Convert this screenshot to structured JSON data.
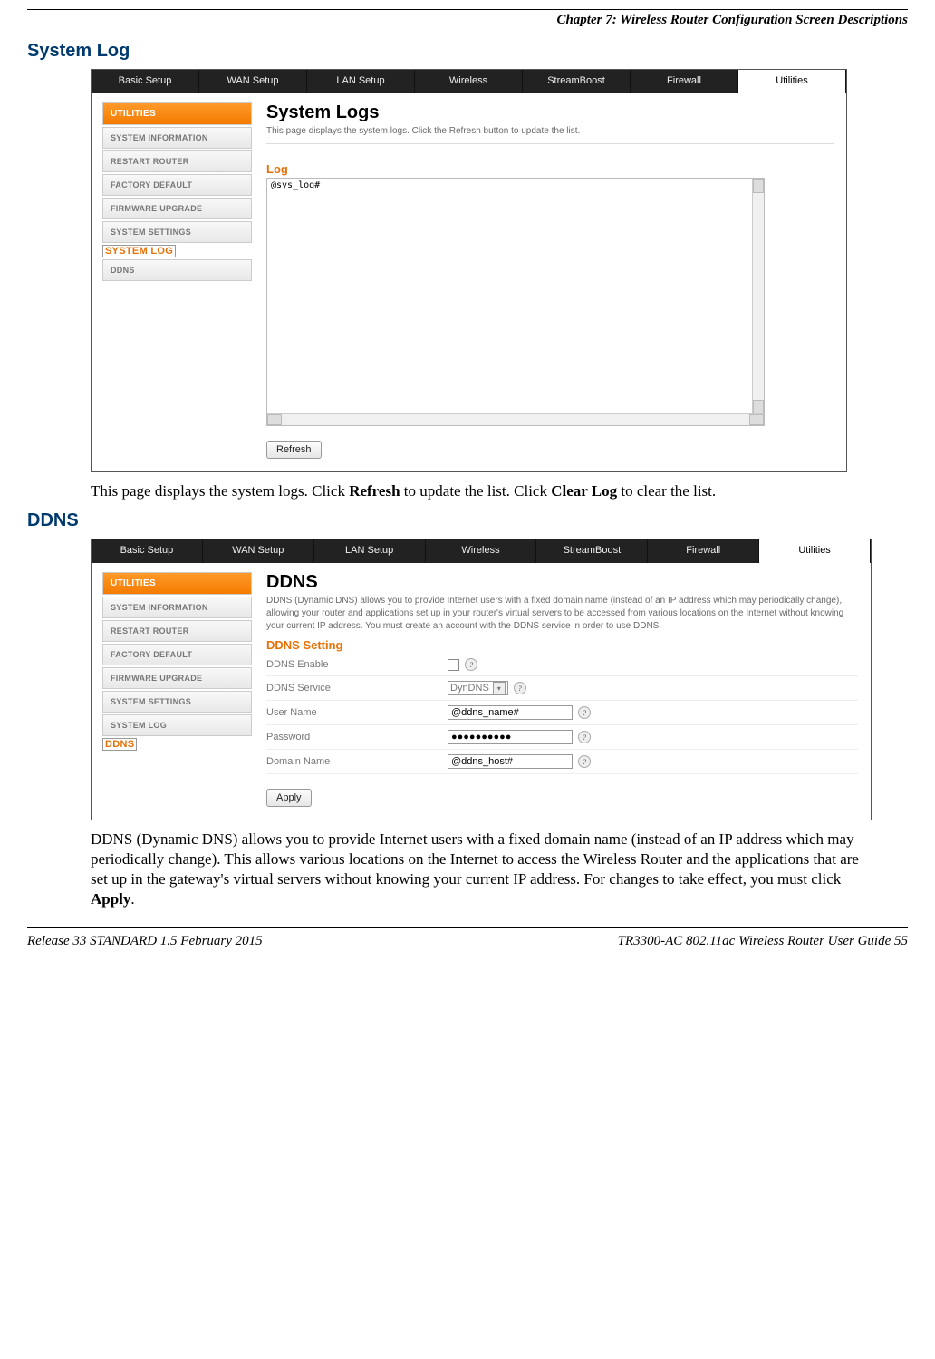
{
  "header": {
    "chapter": "Chapter 7: Wireless Router Configuration Screen Descriptions"
  },
  "sections": {
    "system_log": {
      "heading": "System Log",
      "para_a": "This page displays the system logs.  Click ",
      "para_b": " to update the list.  Click ",
      "para_c": " to clear the list.",
      "bold1": "Refresh",
      "bold2": "Clear Log"
    },
    "ddns": {
      "heading": "DDNS",
      "para_a": "DDNS (Dynamic DNS) allows you to provide Internet users with a fixed domain name (instead of an IP address which may periodically change).  This allows various locations on the Internet to access the Wireless Router and the applications that are set up in the gateway's virtual servers without knowing your current IP address. For changes to take effect, you must click ",
      "bold": "Apply",
      "para_b": "."
    }
  },
  "topnav": {
    "tabs": [
      "Basic Setup",
      "WAN Setup",
      "LAN Setup",
      "Wireless",
      "StreamBoost",
      "Firewall",
      "Utilities"
    ],
    "active": "Utilities"
  },
  "sidebar": {
    "head": "UTILITIES",
    "items": [
      "SYSTEM INFORMATION",
      "RESTART ROUTER",
      "FACTORY DEFAULT",
      "FIRMWARE UPGRADE",
      "SYSTEM SETTINGS",
      "SYSTEM LOG",
      "DDNS"
    ]
  },
  "shot1": {
    "title": "System Logs",
    "sub": "This page displays the system logs. Click the Refresh button to update the list.",
    "sec": "Log",
    "logtext": "@sys_log#",
    "refresh": "Refresh",
    "active_side": "SYSTEM LOG"
  },
  "shot2": {
    "title": "DDNS",
    "sub": "DDNS (Dynamic DNS) allows you to provide Internet users with a fixed domain name (instead of an IP address which may periodically change), allowing your router and applications set up in your router's virtual servers to be accessed from various locations on the Internet without knowing your current IP address. You must create an account with the DDNS service in order to use DDNS.",
    "sec": "DDNS Setting",
    "rows": {
      "enable": "DDNS Enable",
      "service": "DDNS Service",
      "service_val": "DynDNS",
      "user": "User Name",
      "user_val": "@ddns_name#",
      "pass": "Password",
      "pass_val": "●●●●●●●●●●",
      "domain": "Domain Name",
      "domain_val": "@ddns_host#"
    },
    "apply": "Apply",
    "active_side": "DDNS",
    "help": "?"
  },
  "footer": {
    "left": "Release 33 STANDARD 1.5    February 2015",
    "right": "TR3300-AC 802.11ac Wireless Router User Guide    55"
  }
}
